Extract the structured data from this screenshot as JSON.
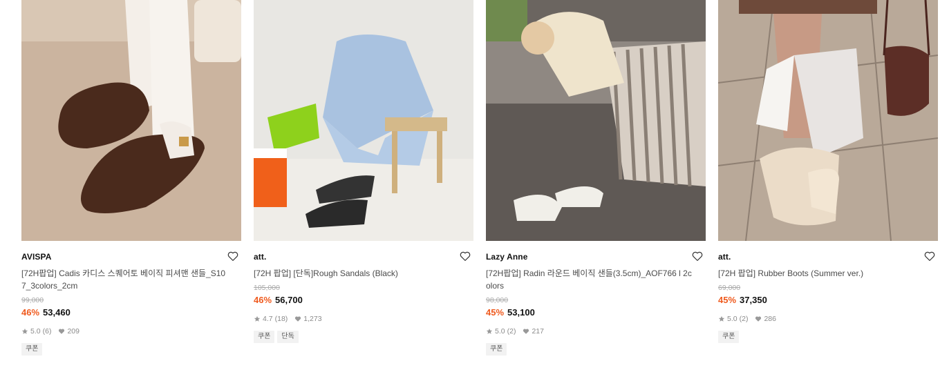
{
  "products": [
    {
      "brand": "AVISPA",
      "name": "[72H팝업] Cadis 카디스 스퀘어토 베이직 피셔맨 샌들_S107_3colors_2cm",
      "original_price": "99,000",
      "discount": "46%",
      "price": "53,460",
      "rating": "5.0",
      "reviews": "(6)",
      "likes": "209",
      "tags": [
        "쿠폰"
      ]
    },
    {
      "brand": "att.",
      "name": "[72H 팝업] [단독]Rough Sandals (Black)",
      "original_price": "105,000",
      "discount": "46%",
      "price": "56,700",
      "rating": "4.7",
      "reviews": "(18)",
      "likes": "1,273",
      "tags": [
        "쿠폰",
        "단독"
      ]
    },
    {
      "brand": "Lazy Anne",
      "name": "[72H팝업] Radin 라운드 베이직 샌들(3.5cm)_AOF766 l 2colors",
      "original_price": "98,000",
      "discount": "45%",
      "price": "53,100",
      "rating": "5.0",
      "reviews": "(2)",
      "likes": "217",
      "tags": [
        "쿠폰"
      ]
    },
    {
      "brand": "att.",
      "name": "[72H 팝업] Rubber Boots (Summer ver.)",
      "original_price": "69,000",
      "discount": "45%",
      "price": "37,350",
      "rating": "5.0",
      "reviews": "(2)",
      "likes": "286",
      "tags": [
        "쿠폰"
      ]
    }
  ],
  "icons": {
    "wishlist": "heart-outline-icon",
    "rating": "star-icon",
    "likes": "heart-filled-icon"
  },
  "colors": {
    "discount": "#ef5a1e",
    "tag_bg": "#f2f2f2"
  }
}
